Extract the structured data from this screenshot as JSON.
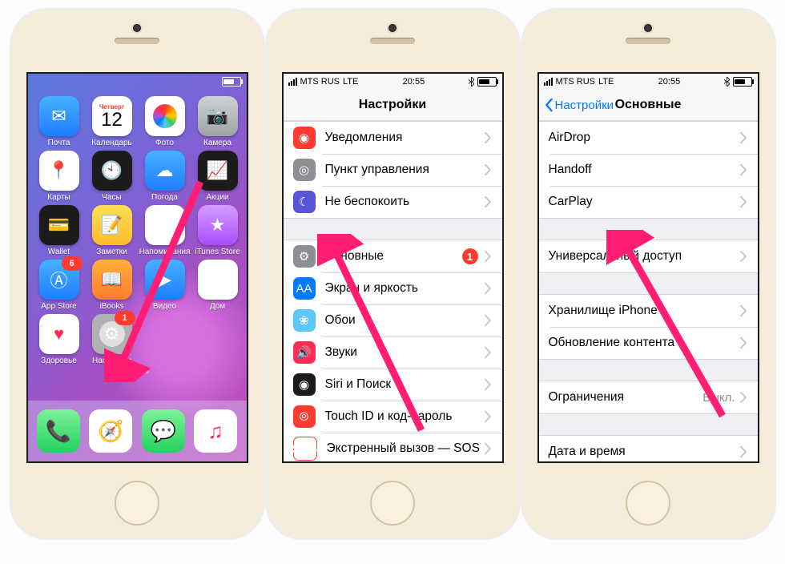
{
  "status_bar": {
    "carrier": "MTS RUS",
    "network": "LTE",
    "time": "20:55",
    "battery_pct": 60
  },
  "phone1": {
    "calendar_day_name": "Четверг",
    "calendar_day_num": "12",
    "apps_row1": [
      {
        "label": "Почта",
        "bg": "bg-blue",
        "glyph": "✉"
      },
      {
        "label": "Календарь",
        "bg": "bg-cal",
        "glyph": ""
      },
      {
        "label": "Фото",
        "bg": "bg-photos",
        "glyph": ""
      },
      {
        "label": "Камера",
        "bg": "bg-grey",
        "glyph": "📷"
      }
    ],
    "apps_row2": [
      {
        "label": "Карты",
        "bg": "bg-green7",
        "glyph": "📍"
      },
      {
        "label": "Часы",
        "bg": "bg-black",
        "glyph": "🕙"
      },
      {
        "label": "Погода",
        "bg": "bg-blue",
        "glyph": "☁"
      },
      {
        "label": "Акции",
        "bg": "bg-black",
        "glyph": "📈"
      }
    ],
    "apps_row3": [
      {
        "label": "Wallet",
        "bg": "bg-black",
        "glyph": "💳"
      },
      {
        "label": "Заметки",
        "bg": "bg-yellow",
        "glyph": "📝"
      },
      {
        "label": "Напоминания",
        "bg": "bg-white",
        "glyph": "☰"
      },
      {
        "label": "iTunes Store",
        "bg": "bg-purple",
        "glyph": "★"
      }
    ],
    "apps_row4": [
      {
        "label": "App Store",
        "bg": "bg-blue",
        "glyph": "Ⓐ",
        "badge": "6"
      },
      {
        "label": "iBooks",
        "bg": "bg-orange",
        "glyph": "📖"
      },
      {
        "label": "Видео",
        "bg": "bg-blue",
        "glyph": "▶"
      },
      {
        "label": "Дом",
        "bg": "bg-house",
        "glyph": "⌂"
      }
    ],
    "apps_row5": [
      {
        "label": "Здоровье",
        "bg": "bg-white",
        "glyph": "♥",
        "color": "#ff2d55"
      },
      {
        "label": "Настройки",
        "bg": "bg-settings",
        "glyph": "⚙",
        "badge": "1"
      }
    ]
  },
  "phone2": {
    "title": "Настройки",
    "group1": [
      {
        "label": "Уведомления",
        "icon": "ri-red",
        "glyph": "◉"
      },
      {
        "label": "Пункт управления",
        "icon": "ri-grey",
        "glyph": "◎"
      },
      {
        "label": "Не беспокоить",
        "icon": "ri-purple",
        "glyph": "☾"
      }
    ],
    "group2": [
      {
        "label": "Основные",
        "icon": "ri-dgrey",
        "glyph": "⚙",
        "badge": "1"
      },
      {
        "label": "Экран и яркость",
        "icon": "ri-blue",
        "glyph": "AA"
      },
      {
        "label": "Обои",
        "icon": "ri-lblue",
        "glyph": "❀"
      },
      {
        "label": "Звуки",
        "icon": "ri-pink",
        "glyph": "🔊"
      },
      {
        "label": "Siri и Поиск",
        "icon": "ri-black",
        "glyph": "◉"
      },
      {
        "label": "Touch ID и код-пароль",
        "icon": "ri-red",
        "glyph": "⦾"
      },
      {
        "label": "Экстренный вызов — SOS",
        "icon": "ri-sos",
        "glyph": "SOS"
      }
    ]
  },
  "phone3": {
    "back_label": "Настройки",
    "title": "Основные",
    "group1": [
      {
        "label": "AirDrop"
      },
      {
        "label": "Handoff"
      },
      {
        "label": "CarPlay"
      }
    ],
    "group2": [
      {
        "label": "Универсальный доступ"
      }
    ],
    "group3": [
      {
        "label": "Хранилище iPhone"
      },
      {
        "label": "Обновление контента"
      }
    ],
    "group4": [
      {
        "label": "Ограничения",
        "value": "Выкл."
      }
    ],
    "group5": [
      {
        "label": "Дата и время"
      }
    ]
  }
}
